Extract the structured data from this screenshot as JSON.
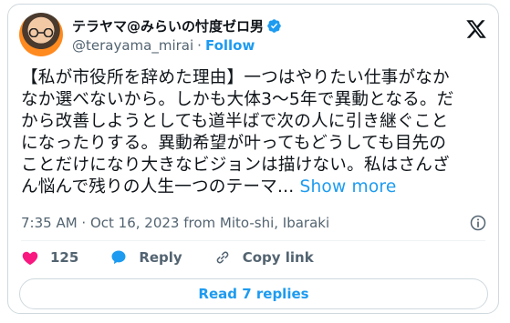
{
  "author": {
    "display_name": "テラヤマ@みらいの忖度ゼロ男",
    "handle": "@terayama_mirai",
    "separator": "·",
    "follow_label": "Follow"
  },
  "tweet": {
    "lines": [
      "【私が市役所を辞めた理由】一つはやりたい仕事がなか",
      "なか選べないから。しかも大体3〜5年で異動となる。だ",
      "から改善しようとしても道半ばで次の人に引き継ぐこと",
      "になったりする。異動希望が叶ってもどうしても目先の",
      "ことだけになり大きなビジョンは描けない。私はさんざ",
      "ん悩んで残りの人生一つのテーマ..."
    ],
    "show_more_label": "Show more",
    "timestamp": "7:35 AM · Oct 16, 2023 from Mito-shi, Ibaraki"
  },
  "actions": {
    "like_count": "125",
    "reply_label": "Reply",
    "copy_link_label": "Copy link"
  },
  "replies_button_label": "Read 7 replies",
  "colors": {
    "accent": "#1d9bf0",
    "like": "#f91880",
    "secondary_text": "#536471",
    "border": "#cfd9de"
  },
  "icons": [
    "avatar",
    "verified-badge-icon",
    "x-logo-icon",
    "info-icon",
    "heart-icon",
    "reply-bubble-icon",
    "link-icon"
  ]
}
